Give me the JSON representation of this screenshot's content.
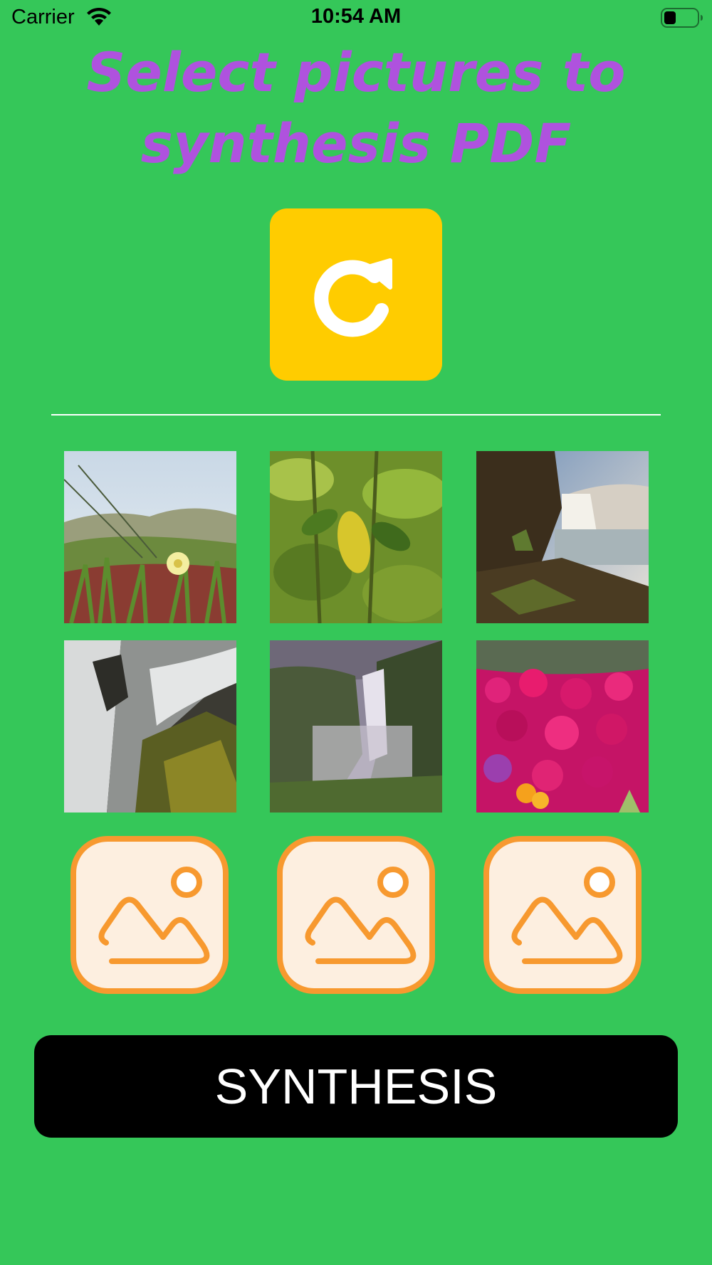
{
  "status_bar": {
    "carrier": "Carrier",
    "time": "10:54 AM",
    "wifi_icon": "wifi-icon",
    "battery_icon": "battery-icon"
  },
  "title": {
    "line1": "Select pictures to",
    "line2": "synthesis PDF",
    "color": "#af52de"
  },
  "refresh_button": {
    "icon": "refresh-icon",
    "color": "#ffcc00"
  },
  "photos": [
    {
      "subject": "ice plant flower on dune"
    },
    {
      "subject": "green citrus leaves"
    },
    {
      "subject": "waterfall over cliff at sunset"
    },
    {
      "subject": "long exposure waterfall over mossy rock"
    },
    {
      "subject": "misty waterfall in canyon"
    },
    {
      "subject": "magenta ice plant flowers"
    }
  ],
  "placeholders": [
    {
      "icon": "image-placeholder-icon"
    },
    {
      "icon": "image-placeholder-icon"
    },
    {
      "icon": "image-placeholder-icon"
    }
  ],
  "synthesis_button": {
    "label": "SYNTHESIS"
  },
  "colors": {
    "background": "#35c759",
    "placeholder_border": "#f7992f",
    "placeholder_fill": "#fdefe0"
  }
}
